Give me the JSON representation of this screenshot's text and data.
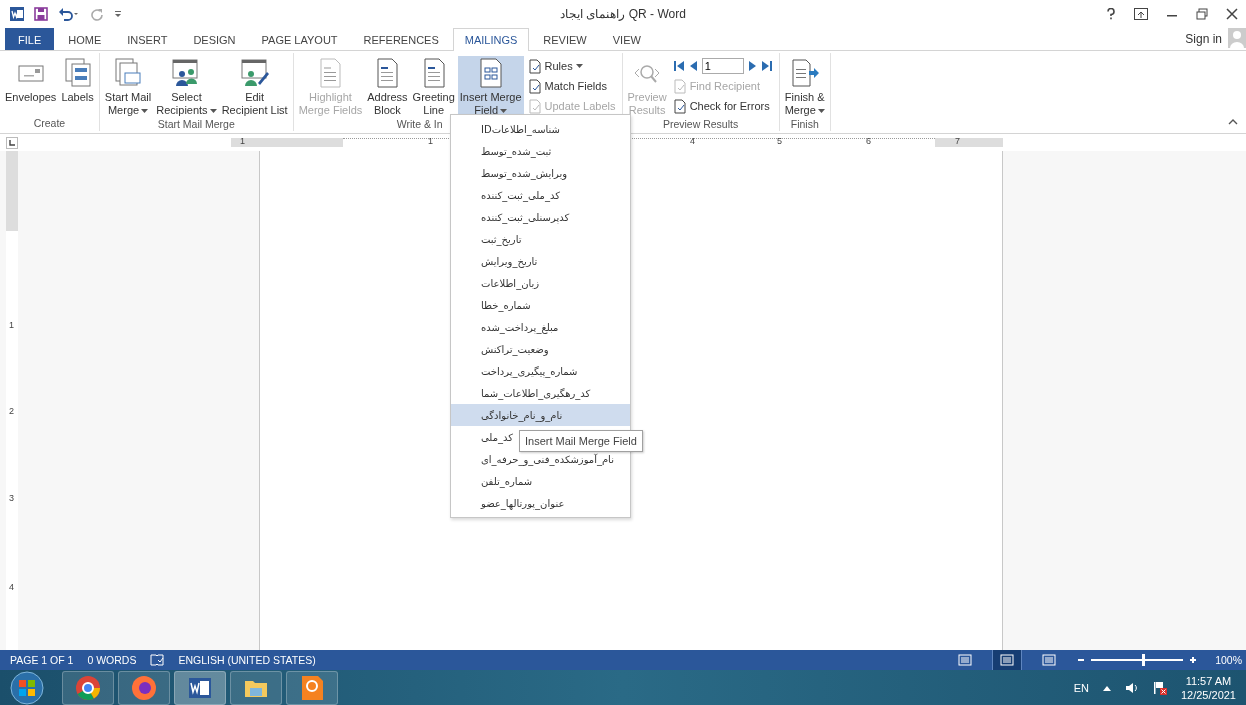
{
  "window": {
    "title": "راهنمای ایجاد QR - Word",
    "sign_in": "Sign in"
  },
  "tabs": [
    {
      "label": "FILE",
      "kind": "file",
      "selected": false
    },
    {
      "label": "HOME",
      "kind": "tab",
      "selected": false
    },
    {
      "label": "INSERT",
      "kind": "tab",
      "selected": false
    },
    {
      "label": "DESIGN",
      "kind": "tab",
      "selected": false
    },
    {
      "label": "PAGE LAYOUT",
      "kind": "tab",
      "selected": false
    },
    {
      "label": "REFERENCES",
      "kind": "tab",
      "selected": false
    },
    {
      "label": "MAILINGS",
      "kind": "tab",
      "selected": true
    },
    {
      "label": "REVIEW",
      "kind": "tab",
      "selected": false
    },
    {
      "label": "VIEW",
      "kind": "tab",
      "selected": false
    }
  ],
  "ribbon": {
    "groups": [
      {
        "label": "Create",
        "items": [
          {
            "kind": "large",
            "lines": [
              "Envelopes"
            ],
            "dropdown": false,
            "disabled": false,
            "expanded": false
          },
          {
            "kind": "large",
            "lines": [
              "Labels"
            ],
            "dropdown": false,
            "disabled": false,
            "expanded": false
          }
        ]
      },
      {
        "label": "Start Mail Merge",
        "items": [
          {
            "kind": "large",
            "lines": [
              "Start Mail",
              "Merge"
            ],
            "dropdown": true,
            "disabled": false,
            "expanded": false
          },
          {
            "kind": "large",
            "lines": [
              "Select",
              "Recipients"
            ],
            "dropdown": true,
            "disabled": false,
            "expanded": false
          },
          {
            "kind": "large",
            "lines": [
              "Edit",
              "Recipient List"
            ],
            "dropdown": false,
            "disabled": false,
            "expanded": false
          }
        ]
      },
      {
        "label": "Write & In",
        "items": [
          {
            "kind": "large",
            "lines": [
              "Highlight",
              "Merge Fields"
            ],
            "dropdown": false,
            "disabled": true,
            "expanded": false
          },
          {
            "kind": "large",
            "lines": [
              "Address",
              "Block"
            ],
            "dropdown": false,
            "disabled": false,
            "expanded": false
          },
          {
            "kind": "large",
            "lines": [
              "Greeting",
              "Line"
            ],
            "dropdown": false,
            "disabled": false,
            "expanded": false
          },
          {
            "kind": "large",
            "lines": [
              "Insert Merge",
              "Field"
            ],
            "dropdown": true,
            "disabled": false,
            "expanded": true
          },
          {
            "kind": "column",
            "items": [
              {
                "kind": "small",
                "label": "Rules",
                "dropdown": true,
                "disabled": false
              },
              {
                "kind": "small",
                "label": "Match Fields",
                "dropdown": false,
                "disabled": false
              },
              {
                "kind": "small",
                "label": "Update Labels",
                "dropdown": false,
                "disabled": true
              }
            ]
          }
        ]
      },
      {
        "label": "Preview Results",
        "items": [
          {
            "kind": "large",
            "lines": [
              "Preview",
              "Results"
            ],
            "dropdown": false,
            "disabled": true,
            "expanded": false
          },
          {
            "kind": "column",
            "items": [
              {
                "kind": "nav",
                "value": "1"
              },
              {
                "kind": "small",
                "label": "Find Recipient",
                "dropdown": false,
                "disabled": true
              },
              {
                "kind": "small",
                "label": "Check for Errors",
                "dropdown": false,
                "disabled": false
              }
            ]
          }
        ]
      },
      {
        "label": "Finish",
        "items": [
          {
            "kind": "large",
            "lines": [
              "Finish &",
              "Merge"
            ],
            "dropdown": true,
            "disabled": false,
            "expanded": false
          }
        ]
      }
    ]
  },
  "ruler": {
    "horizontal": [
      "1",
      "1",
      "4",
      "5",
      "6",
      "7"
    ],
    "vertical": [
      "1",
      "2",
      "3",
      "4"
    ]
  },
  "merge_field_menu": {
    "items": [
      {
        "label": "شناسه_اطلاعاتID",
        "selected": false
      },
      {
        "label": "ثبت_شده_توسط",
        "selected": false
      },
      {
        "label": "ویرایش_شده_توسط",
        "selected": false
      },
      {
        "label": "کد_ملی_ثبت_کننده",
        "selected": false
      },
      {
        "label": "کدپرسنلی_ثبت_کننده",
        "selected": false
      },
      {
        "label": "تاریخ_ثبت",
        "selected": false
      },
      {
        "label": "تاریخ_ویرایش",
        "selected": false
      },
      {
        "label": "زبان_اطلاعات",
        "selected": false
      },
      {
        "label": "شماره_خطا",
        "selected": false
      },
      {
        "label": "مبلغ_پرداخت_شده",
        "selected": false
      },
      {
        "label": "وضعیت_تراکنش",
        "selected": false
      },
      {
        "label": "شماره_پیگیری_پرداخت",
        "selected": false
      },
      {
        "label": "کد_رهگیری_اطلاعات_شما",
        "selected": false
      },
      {
        "label": "نام_و_نام_خانوادگی",
        "selected": true
      },
      {
        "label": "کد_ملی",
        "selected": false
      },
      {
        "label": "نام_آموزشکده_فنی_و_حرفه_ای",
        "selected": false
      },
      {
        "label": "شماره_تلفن",
        "selected": false
      },
      {
        "label": "عنوان_پورتالها_عضو",
        "selected": false
      }
    ],
    "tooltip": "Insert Mail Merge Field"
  },
  "status_bar": {
    "page": "PAGE 1 OF 1",
    "words": "0 WORDS",
    "language": "ENGLISH (UNITED STATES)",
    "views": [
      {
        "selected": false
      },
      {
        "selected": true
      },
      {
        "selected": false
      }
    ],
    "zoom": {
      "level": 0.56,
      "reading": "100%"
    }
  },
  "taskbar": {
    "apps": [
      {
        "selected": false
      },
      {
        "selected": false
      },
      {
        "selected": true
      },
      {
        "selected": false
      },
      {
        "selected": false
      }
    ],
    "language": "EN",
    "time": "11:57 AM",
    "date": "12/25/2021"
  }
}
